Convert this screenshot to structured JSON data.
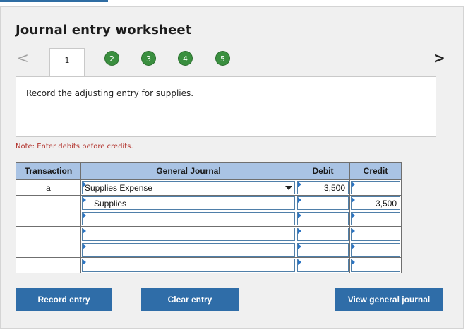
{
  "worksheet": {
    "title": "Journal entry worksheet",
    "nav_prev": "<",
    "nav_next": ">",
    "steps": [
      "1",
      "2",
      "3",
      "4",
      "5"
    ],
    "active_step": "1",
    "instruction": "Record the adjusting entry for supplies.",
    "note": "Note: Enter debits before credits."
  },
  "journal": {
    "headers": {
      "transaction": "Transaction",
      "general_journal": "General Journal",
      "debit": "Debit",
      "credit": "Credit"
    },
    "rows": [
      {
        "transaction": "a",
        "account": "Supplies Expense",
        "debit": "3,500",
        "credit": ""
      },
      {
        "transaction": "",
        "account": "Supplies",
        "debit": "",
        "credit": "3,500"
      },
      {
        "transaction": "",
        "account": "",
        "debit": "",
        "credit": ""
      },
      {
        "transaction": "",
        "account": "",
        "debit": "",
        "credit": ""
      },
      {
        "transaction": "",
        "account": "",
        "debit": "",
        "credit": ""
      },
      {
        "transaction": "",
        "account": "",
        "debit": "",
        "credit": ""
      }
    ]
  },
  "buttons": {
    "record": "Record entry",
    "clear": "Clear entry",
    "view": "View general journal"
  },
  "colors": {
    "step_circle": "#3a8f3f",
    "header_bg": "#a9c3e4",
    "button_bg": "#2f6da8",
    "note_text": "#b2332d"
  }
}
